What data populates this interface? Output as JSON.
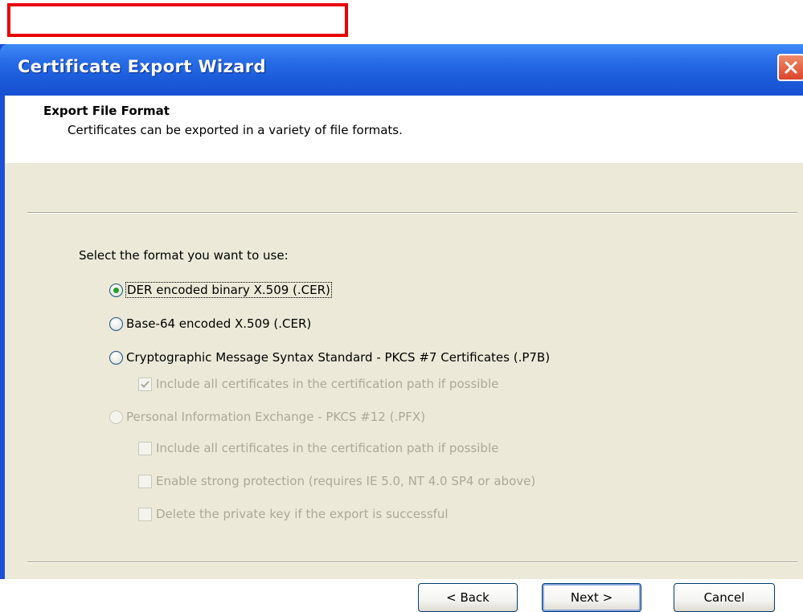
{
  "window": {
    "title": "Certificate Export Wizard"
  },
  "header": {
    "title": "Export File Format",
    "subtitle": "Certificates can be exported in a variety of file formats."
  },
  "form": {
    "prompt": "Select the format you want to use:",
    "options": [
      {
        "label": "DER encoded binary X.509 (.CER)",
        "mnemonic": "D",
        "selected": true,
        "enabled": true
      },
      {
        "label": "Base-64 encoded X.509 (.CER)",
        "mnemonic": "s",
        "selected": false,
        "enabled": true
      },
      {
        "label": "Cryptographic Message Syntax Standard - PKCS #7 Certificates (.P7B)",
        "mnemonic": "C",
        "selected": false,
        "enabled": true
      },
      {
        "label": "Personal Information Exchange - PKCS #12 (.PFX)",
        "mnemonic": "P",
        "selected": false,
        "enabled": false
      }
    ],
    "p7b_checkbox": {
      "label": "Include all certificates in the certification path if possible",
      "mnemonic": "I",
      "checked": true,
      "enabled": false
    },
    "pfx_checkboxes": [
      {
        "label": "Include all certificates in the certification path if possible",
        "mnemonic": "u",
        "checked": false,
        "enabled": false
      },
      {
        "label": "Enable strong protection (requires IE 5.0, NT 4.0 SP4 or above)",
        "mnemonic": "E",
        "checked": false,
        "enabled": false
      },
      {
        "label": "Delete the private key if the export is successful",
        "mnemonic": "k",
        "checked": false,
        "enabled": false
      }
    ]
  },
  "buttons": {
    "back": "< Back",
    "next": "Next >",
    "cancel": "Cancel"
  },
  "colors": {
    "titlebar": "#2a6ee8",
    "dialog_bg": "#ece9d8",
    "selected_radio": "#21a121",
    "annotation_box": "#e80000",
    "disabled_text": "#aca899"
  }
}
